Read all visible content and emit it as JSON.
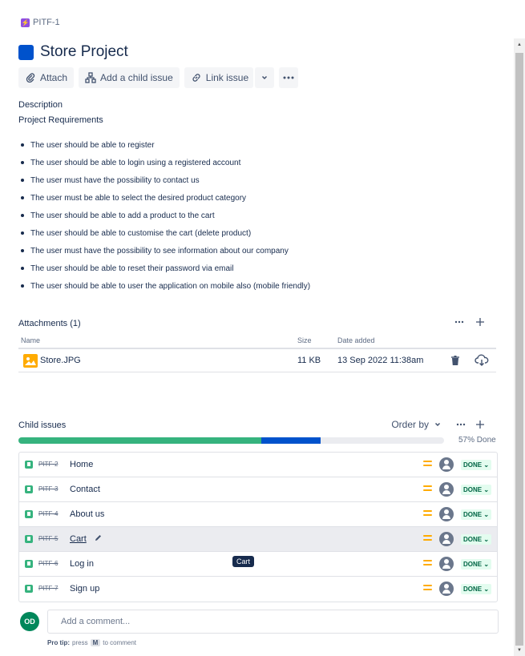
{
  "breadcrumb": {
    "key": "PITF-1"
  },
  "issue": {
    "title": "Store Project"
  },
  "toolbar": {
    "attach": "Attach",
    "add_child": "Add a child issue",
    "link_issue": "Link issue"
  },
  "description": {
    "heading": "Description",
    "subheading": "Project Requirements",
    "items": [
      "The user should be able to register",
      "The user should be able to login using a registered account",
      "The user must have the possibility to contact us",
      "The user must be able to select the desired product category",
      "The user should be able to add a product to the cart",
      "The user should be able to customise the cart (delete product)",
      "The user must have the possibility to see information about our company",
      "The user should be able to reset their password via email",
      "The user should be able to user the application on mobile also (mobile friendly)"
    ]
  },
  "attachments": {
    "heading": "Attachments (1)",
    "columns": {
      "name": "Name",
      "size": "Size",
      "date": "Date added"
    },
    "files": [
      {
        "name": "Store.JPG",
        "size": "11 KB",
        "date": "13 Sep 2022 11:38am"
      }
    ]
  },
  "child_issues": {
    "heading": "Child issues",
    "order_by": "Order by",
    "progress": {
      "done_fraction": 0.57,
      "in_progress_fraction": 0.14,
      "label": "57% Done"
    },
    "items": [
      {
        "key": "PITF-2",
        "summary": "Home",
        "status": "DONE"
      },
      {
        "key": "PITF-3",
        "summary": "Contact",
        "status": "DONE"
      },
      {
        "key": "PITF-4",
        "summary": "About us",
        "status": "DONE"
      },
      {
        "key": "PITF-5",
        "summary": "Cart",
        "status": "DONE"
      },
      {
        "key": "PITF-6",
        "summary": "Log in",
        "status": "DONE"
      },
      {
        "key": "PITF-7",
        "summary": "Sign up",
        "status": "DONE"
      }
    ]
  },
  "tooltip": "Cart",
  "comment": {
    "avatar_initials": "OD",
    "placeholder": "Add a comment...",
    "protip_label": "Pro tip:",
    "protip_text_1": "press",
    "protip_key": "M",
    "protip_text_2": "to comment"
  },
  "colors": {
    "accent": "#0052cc",
    "done": "#36b37e",
    "priority": "#ffab00"
  }
}
